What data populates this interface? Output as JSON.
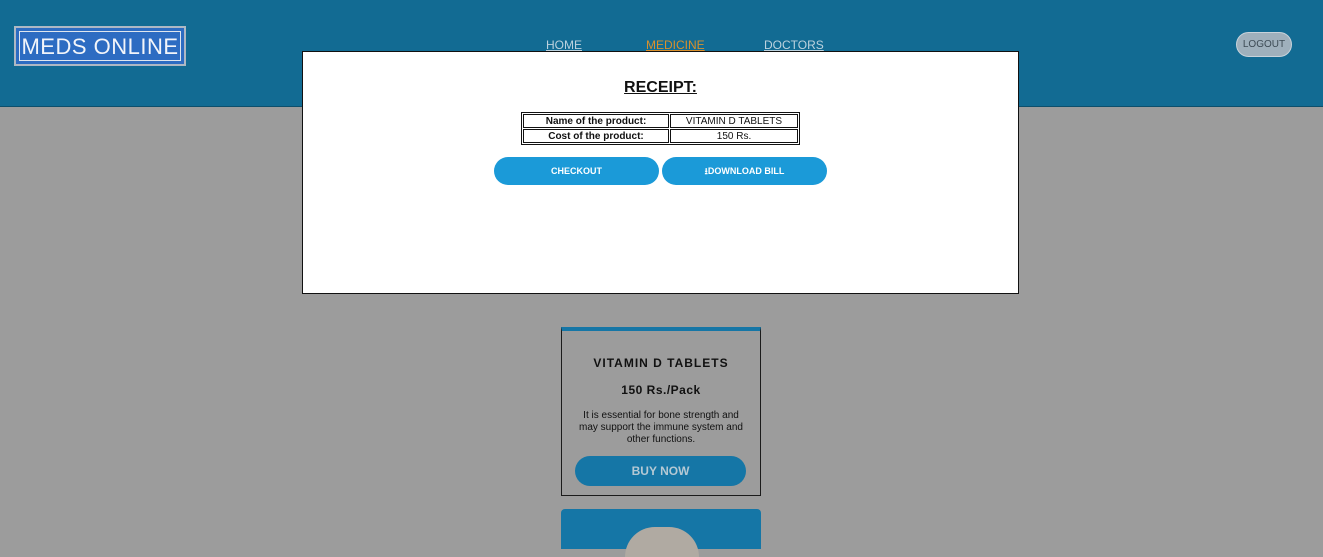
{
  "header": {
    "logo_text": "MEDS ONLINE",
    "nav": {
      "home": "HOME",
      "medicine": "MEDICINE",
      "doctors": "DOCTORS"
    },
    "logout_label": "LOGOUT"
  },
  "product": {
    "name": "VITAMIN D TABLETS",
    "price": "150 Rs./Pack",
    "description": "It is essential for bone strength and may support the immune system and other functions.",
    "buy_label": "BUY NOW"
  },
  "receipt": {
    "title": "RECEIPT:",
    "rows": [
      {
        "label": "Name of the product:",
        "value": "VITAMIN D TABLETS"
      },
      {
        "label": "Cost of the product:",
        "value": "150 Rs."
      }
    ],
    "checkout_label": "CHECKOUT",
    "download_icon": "download-icon",
    "download_label": "DOWNLOAD BILL"
  },
  "colors": {
    "header_bg": "#126b93",
    "active_nav": "#d9902c",
    "button_bg": "#1b9ad8",
    "overlay_bg": "#9c9c9c"
  }
}
